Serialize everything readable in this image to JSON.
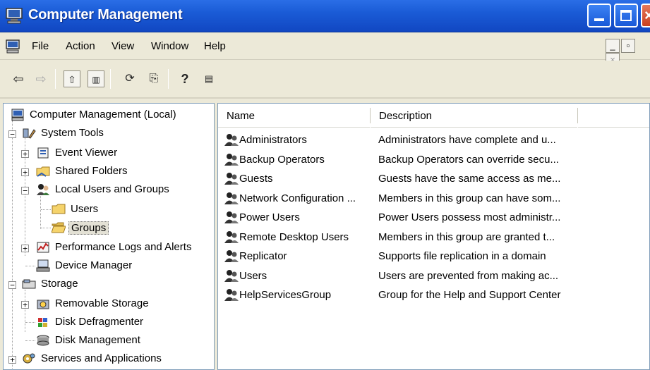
{
  "window": {
    "title": "Computer Management"
  },
  "menu": {
    "items": [
      "File",
      "Action",
      "View",
      "Window",
      "Help"
    ]
  },
  "tree": {
    "items": [
      {
        "label": "Computer Management (Local)",
        "icon": "computer-icon"
      },
      {
        "label": "System Tools",
        "icon": "tools-icon"
      },
      {
        "label": "Event Viewer",
        "icon": "event-viewer-icon"
      },
      {
        "label": "Shared Folders",
        "icon": "shared-folder-icon"
      },
      {
        "label": "Local Users and Groups",
        "icon": "users-icon"
      },
      {
        "label": "Users",
        "icon": "folder-icon"
      },
      {
        "label": "Groups",
        "icon": "folder-open-icon"
      },
      {
        "label": "Performance Logs and Alerts",
        "icon": "performance-icon"
      },
      {
        "label": "Device Manager",
        "icon": "device-manager-icon"
      },
      {
        "label": "Storage",
        "icon": "storage-icon"
      },
      {
        "label": "Removable Storage",
        "icon": "removable-storage-icon"
      },
      {
        "label": "Disk Defragmenter",
        "icon": "defrag-icon"
      },
      {
        "label": "Disk Management",
        "icon": "disk-management-icon"
      },
      {
        "label": "Services and Applications",
        "icon": "services-icon"
      }
    ],
    "selected": "Groups"
  },
  "list": {
    "columns": [
      "Name",
      "Description"
    ],
    "rows": [
      {
        "name": "Administrators",
        "description": "Administrators have complete and u..."
      },
      {
        "name": "Backup Operators",
        "description": "Backup Operators can override secu..."
      },
      {
        "name": "Guests",
        "description": "Guests have the same access as me..."
      },
      {
        "name": "Network Configuration ...",
        "description": "Members in this group can have som..."
      },
      {
        "name": "Power Users",
        "description": "Power Users possess most administr..."
      },
      {
        "name": "Remote Desktop Users",
        "description": "Members in this group are granted t..."
      },
      {
        "name": "Replicator",
        "description": "Supports file replication in a domain"
      },
      {
        "name": "Users",
        "description": "Users are prevented from making ac..."
      },
      {
        "name": "HelpServicesGroup",
        "description": "Group for the Help and Support Center"
      }
    ]
  },
  "colors": {
    "titlebar": "#1a5bd6",
    "face": "#ece9d8",
    "border": "#7f9db9"
  }
}
